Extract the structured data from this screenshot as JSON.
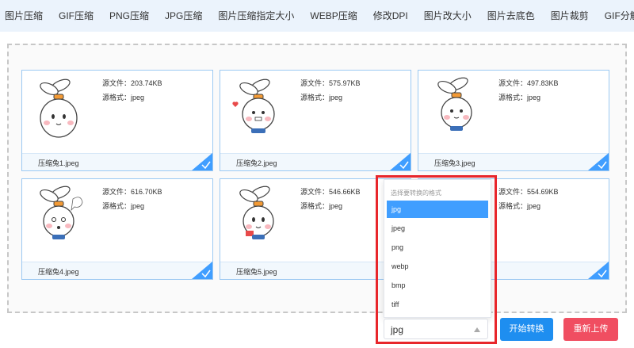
{
  "nav": {
    "items": [
      "图片压缩",
      "GIF压缩",
      "PNG压缩",
      "JPG压缩",
      "图片压缩指定大小",
      "WEBP压缩",
      "修改DPI",
      "图片改大小",
      "图片去底色",
      "图片裁剪",
      "GIF分解"
    ]
  },
  "cards": [
    {
      "name": "压缩兔1.jpeg",
      "size": "源文件：203.74KB",
      "format": "源格式：jpeg"
    },
    {
      "name": "压缩兔2.jpeg",
      "size": "源文件：575.97KB",
      "format": "源格式：jpeg"
    },
    {
      "name": "压缩兔3.jpeg",
      "size": "源文件：497.83KB",
      "format": "源格式：jpeg"
    },
    {
      "name": "压缩兔4.jpeg",
      "size": "源文件：616.70KB",
      "format": "源格式：jpeg"
    },
    {
      "name": "压缩兔5.jpeg",
      "size": "源文件：546.66KB",
      "format": "源格式：jpeg"
    },
    {
      "name": "",
      "size": "源文件：554.69KB",
      "format": "源格式：jpeg"
    }
  ],
  "dropdown": {
    "placeholder": "选择要转换的格式",
    "options": [
      "jpg",
      "jpeg",
      "png",
      "webp",
      "bmp",
      "tiff"
    ],
    "selected": "jpg"
  },
  "select": {
    "value": "jpg"
  },
  "buttons": {
    "start": "开始转换",
    "reupload": "重新上传"
  },
  "colors": {
    "accent": "#1e8ef0",
    "danger": "#f04e61",
    "highlight": "#e8262b",
    "card_border": "#9cc9f2"
  }
}
